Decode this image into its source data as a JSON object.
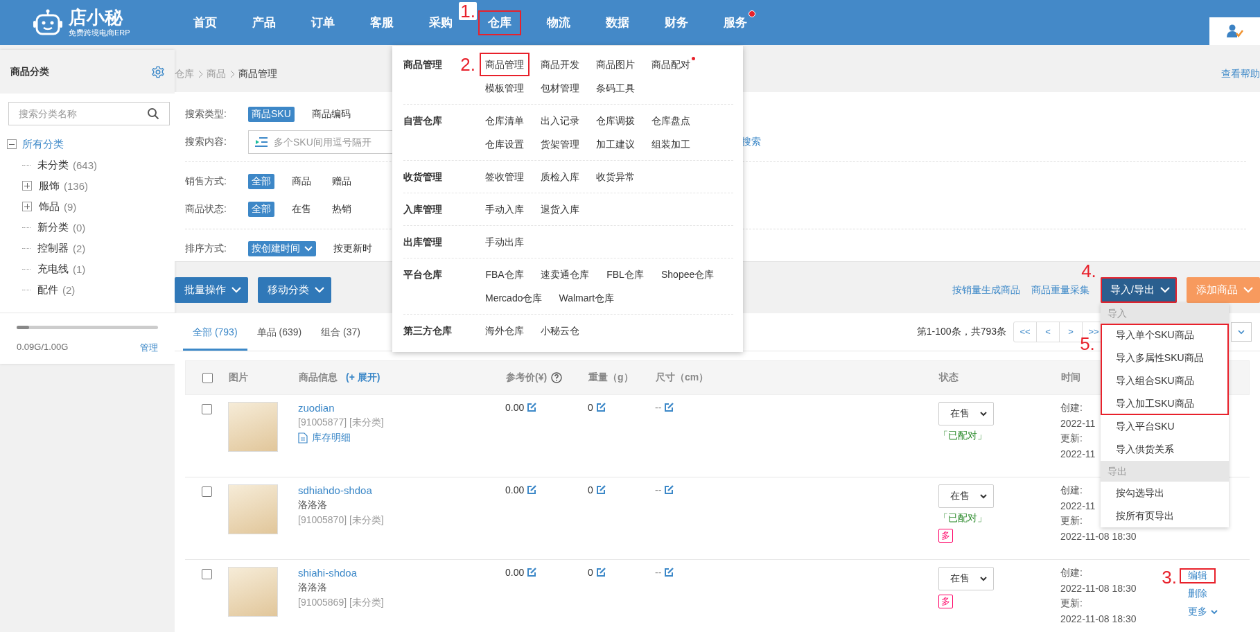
{
  "header": {
    "logo": {
      "name": "店小秘",
      "tagline": "免费跨境电商ERP"
    },
    "nav": [
      {
        "label": "首页",
        "highlighted": false,
        "dot": false
      },
      {
        "label": "产品",
        "highlighted": false,
        "dot": false
      },
      {
        "label": "订单",
        "highlighted": false,
        "dot": false
      },
      {
        "label": "客服",
        "highlighted": false,
        "dot": false
      },
      {
        "label": "采购",
        "highlighted": false,
        "dot": false
      },
      {
        "label": "仓库",
        "highlighted": true,
        "mark": "1.",
        "dot": false
      },
      {
        "label": "物流",
        "highlighted": false,
        "dot": false
      },
      {
        "label": "数据",
        "highlighted": false,
        "dot": false
      },
      {
        "label": "财务",
        "highlighted": false,
        "dot": false
      },
      {
        "label": "服务",
        "highlighted": false,
        "dot": true
      }
    ]
  },
  "sidebar": {
    "title": "商品分类",
    "search": {
      "placeholder": "搜索分类名称"
    },
    "tree": {
      "label": "所有分类",
      "expanded": true,
      "children": [
        {
          "label": "未分类",
          "count": "(643)",
          "collapsed": false
        },
        {
          "label": "服饰",
          "count": "(136)",
          "collapsed": true
        },
        {
          "label": "饰品",
          "count": "(9)",
          "collapsed": true
        },
        {
          "label": "新分类",
          "count": "(0)",
          "collapsed": false
        },
        {
          "label": "控制器",
          "count": "(2)",
          "collapsed": false
        },
        {
          "label": "充电线",
          "count": "(1)",
          "collapsed": false
        },
        {
          "label": "配件",
          "count": "(2)",
          "collapsed": false
        }
      ]
    },
    "storage": {
      "level": 0.09,
      "usage": "0.09G/1.00G",
      "manage": "管理"
    }
  },
  "breadcrumb": [
    "仓库",
    "商品",
    "商品管理"
  ],
  "help_link": "查看帮助",
  "filter_groups": [
    [
      {
        "label": "搜索类型:",
        "kind": "options",
        "options": [
          {
            "label": "商品SKU",
            "selected": true,
            "dropdown": false
          },
          {
            "label": "商品编码",
            "selected": false,
            "dropdown": false
          }
        ]
      },
      {
        "label": "搜索内容:",
        "kind": "input",
        "placeholder": "多个SKU间用逗号隔开",
        "link": "搜索"
      }
    ],
    [
      {
        "label": "销售方式:",
        "kind": "options",
        "options": [
          {
            "label": "全部",
            "selected": true,
            "dropdown": false
          },
          {
            "label": "商品",
            "selected": false,
            "dropdown": false
          },
          {
            "label": "赠品",
            "selected": false,
            "dropdown": false
          }
        ]
      },
      {
        "label": "商品状态:",
        "kind": "options",
        "options": [
          {
            "label": "全部",
            "selected": true,
            "dropdown": false
          },
          {
            "label": "在售",
            "selected": false,
            "dropdown": false
          },
          {
            "label": "热销",
            "selected": false,
            "dropdown": false
          }
        ]
      }
    ],
    [
      {
        "label": "排序方式:",
        "kind": "options",
        "options": [
          {
            "label": "按创建时间",
            "selected": true,
            "dropdown": true
          },
          {
            "label": "按更新时",
            "selected": false,
            "dropdown": false
          }
        ]
      }
    ]
  ],
  "toolbar": {
    "buttons": [
      "批量操作",
      "移动分类"
    ],
    "links": [
      "按销量生成商品",
      "商品重量采集"
    ],
    "import_export": {
      "label": "导入/导出",
      "highlighted": true,
      "mark": "4."
    },
    "add": "添加商品"
  },
  "tabs": [
    {
      "label": "全部 (793)",
      "selected": true
    },
    {
      "label": "单品 (639)",
      "selected": false
    },
    {
      "label": "组合 (37)",
      "selected": false
    }
  ],
  "pagination": {
    "summary": "第1-100条，共793条",
    "buttons": [
      "<<",
      "<",
      ">",
      ">>"
    ]
  },
  "table": {
    "select_all_checked": false,
    "columns": [
      {
        "label": "图片",
        "help": false
      },
      {
        "label": "商品信息",
        "link": "(+ 展开)",
        "help": false
      },
      {
        "label": "参考价(¥)",
        "help": true
      },
      {
        "label": "重量（g）",
        "help": false
      },
      {
        "label": "尺寸（cm）",
        "help": false
      },
      {
        "label": "状态",
        "help": false
      },
      {
        "label": "时间",
        "help": false
      }
    ],
    "rows": [
      {
        "checked": false,
        "name": "zuodian",
        "code": "[91005877] [未分类]",
        "stock_link": "库存明细",
        "price": "0.00",
        "weight": "0",
        "size": "--",
        "status": "在售",
        "paired": "「已配对」",
        "created_label": "创建:",
        "created": "2022-11",
        "updated_label": "更新:",
        "updated": "2022-11",
        "actions": []
      },
      {
        "checked": false,
        "name": "sdhiahdo-shdoa",
        "subtitle": "洛洛洛",
        "code": "[91005870] [未分类]",
        "price": "0.00",
        "weight": "0",
        "size": "--",
        "status": "在售",
        "paired": "「已配对」",
        "multi": "多",
        "created_label": "创建:",
        "created": "2022-11",
        "updated_label": "更新:",
        "updated": "2022-11-08 18:30",
        "actions": []
      },
      {
        "checked": false,
        "name": "shiahi-shdoa",
        "subtitle": "洛洛洛",
        "code": "[91005869] [未分类]",
        "price": "0.00",
        "weight": "0",
        "size": "--",
        "status": "在售",
        "multi": "多",
        "created_label": "创建:",
        "created": "2022-11-08 18:30",
        "updated_label": "更新:",
        "updated": "2022-11-08 18:30",
        "actions": [
          {
            "label": "编辑",
            "highlighted": true,
            "mark": "3.",
            "caret": false
          },
          {
            "label": "删除",
            "highlighted": false,
            "caret": false
          },
          {
            "label": "更多",
            "highlighted": false,
            "caret": true
          }
        ]
      }
    ]
  },
  "warehouse_menu": [
    {
      "label": "商品管理",
      "items": [
        {
          "label": "商品管理",
          "highlighted": true,
          "mark": "2.",
          "dot": false
        },
        {
          "label": "商品开发",
          "highlighted": false,
          "dot": false
        },
        {
          "label": "商品图片",
          "highlighted": false,
          "dot": false
        },
        {
          "label": "商品配对",
          "highlighted": false,
          "dot": true
        },
        {
          "label": "模板管理",
          "highlighted": false,
          "dot": false
        },
        {
          "label": "包材管理",
          "highlighted": false,
          "dot": false
        },
        {
          "label": "条码工具",
          "highlighted": false,
          "dot": false
        }
      ]
    },
    {
      "label": "自营仓库",
      "items": [
        {
          "label": "仓库清单",
          "highlighted": false,
          "dot": false
        },
        {
          "label": "出入记录",
          "highlighted": false,
          "dot": false
        },
        {
          "label": "仓库调拨",
          "highlighted": false,
          "dot": false
        },
        {
          "label": "仓库盘点",
          "highlighted": false,
          "dot": false
        },
        {
          "label": "仓库设置",
          "highlighted": false,
          "dot": false
        },
        {
          "label": "货架管理",
          "highlighted": false,
          "dot": false
        },
        {
          "label": "加工建议",
          "highlighted": false,
          "dot": false
        },
        {
          "label": "组装加工",
          "highlighted": false,
          "dot": false
        }
      ]
    },
    {
      "label": "收货管理",
      "items": [
        {
          "label": "签收管理",
          "highlighted": false,
          "dot": false
        },
        {
          "label": "质检入库",
          "highlighted": false,
          "dot": false
        },
        {
          "label": "收货异常",
          "highlighted": false,
          "dot": false
        }
      ]
    },
    {
      "label": "入库管理",
      "items": [
        {
          "label": "手动入库",
          "highlighted": false,
          "dot": false
        },
        {
          "label": "退货入库",
          "highlighted": false,
          "dot": false
        }
      ]
    },
    {
      "label": "出库管理",
      "items": [
        {
          "label": "手动出库",
          "highlighted": false,
          "dot": false
        }
      ]
    },
    {
      "label": "平台仓库",
      "items": [
        {
          "label": "FBA仓库",
          "highlighted": false,
          "dot": false
        },
        {
          "label": "速卖通仓库",
          "highlighted": false,
          "dot": false
        },
        {
          "label": "FBL仓库",
          "highlighted": false,
          "dot": false
        },
        {
          "label": "Shopee仓库",
          "highlighted": false,
          "dot": false
        },
        {
          "label": "Mercado仓库",
          "highlighted": false,
          "dot": false
        },
        {
          "label": "Walmart仓库",
          "highlighted": false,
          "dot": false
        }
      ]
    },
    {
      "label": "第三方仓库",
      "items": [
        {
          "label": "海外仓库",
          "highlighted": false,
          "dot": false
        },
        {
          "label": "小秘云仓",
          "highlighted": false,
          "dot": false
        }
      ]
    }
  ],
  "import_export_menu": [
    {
      "header": "导入",
      "groups": [
        {
          "highlighted": true,
          "mark": "5.",
          "items": [
            "导入单个SKU商品",
            "导入多属性SKU商品",
            "导入组合SKU商品",
            "导入加工SKU商品"
          ]
        },
        {
          "highlighted": false,
          "items": [
            "导入平台SKU",
            "导入供货关系"
          ]
        }
      ]
    },
    {
      "header": "导出",
      "groups": [
        {
          "highlighted": false,
          "items": [
            "按勾选导出",
            "按所有页导出"
          ]
        }
      ]
    }
  ]
}
